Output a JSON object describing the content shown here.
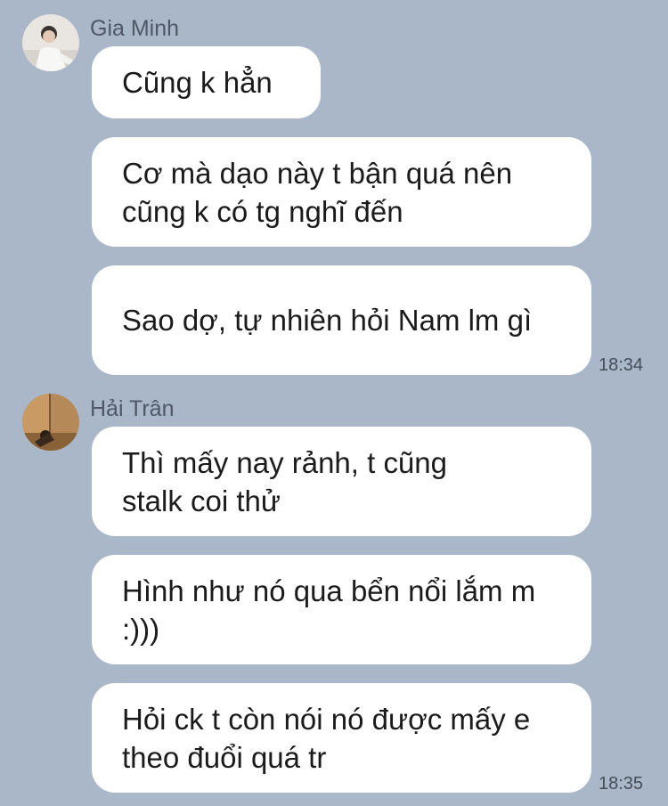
{
  "conversation": {
    "groups": [
      {
        "sender": "Gia Minh",
        "avatar_icon": "user-avatar-photo-icon",
        "messages": [
          {
            "text": "Cũng k hẳn"
          },
          {
            "text": "Cơ mà dạo này t bận quá nên cũng k có tg nghĩ đến"
          },
          {
            "text": "Sao dợ, tự nhiên hỏi Nam lm gì",
            "time": "18:34"
          }
        ]
      },
      {
        "sender": "Hải Trân",
        "avatar_icon": "user-avatar-photo-icon",
        "messages": [
          {
            "text": "Thì mấy nay rảnh, t cũng stalk coi thử"
          },
          {
            "text": "Hình như nó qua bển nổi lắm m :)))"
          },
          {
            "text": "Hỏi ck t còn nói nó được mấy e theo đuổi quá tr",
            "time": "18:35"
          }
        ]
      }
    ]
  },
  "colors": {
    "background": "#a9b7c9",
    "bubble": "#ffffff",
    "sender_name": "#4e5866",
    "timestamp": "#454d58"
  }
}
